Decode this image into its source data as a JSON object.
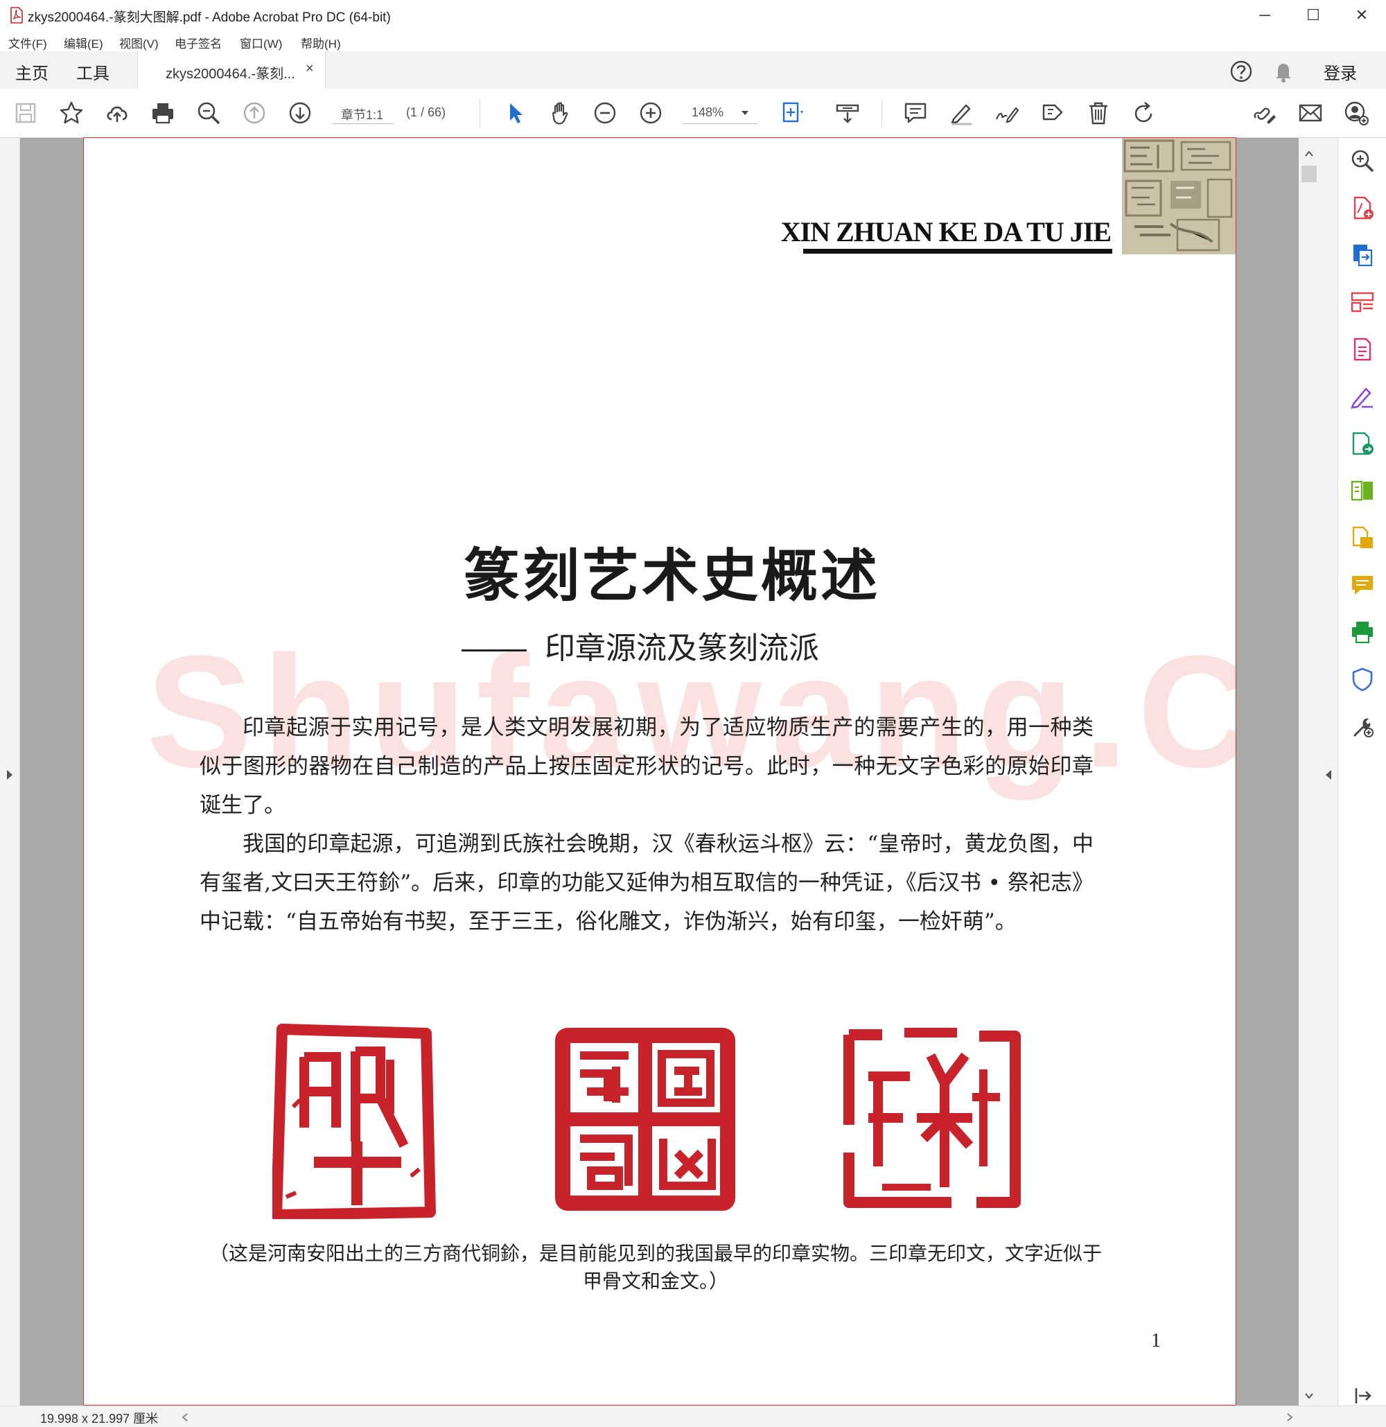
{
  "window": {
    "title": "zkys2000464.-篆刻大图解.pdf - Adobe Acrobat Pro DC (64-bit)",
    "minimize": "─",
    "maximize": "☐",
    "close": "✕"
  },
  "menu": [
    "文件(F)",
    "编辑(E)",
    "视图(V)",
    "电子签名",
    "窗口(W)",
    "帮助(H)"
  ],
  "tabs": {
    "home": "主页",
    "tools": "工具",
    "document": "zkys2000464.-篆刻...",
    "close": "×",
    "login": "登录"
  },
  "toolbar": {
    "chapter": "章节1:1",
    "page_count": "(1 / 66)",
    "zoom": "148%"
  },
  "page": {
    "header_en": "XIN ZHUAN KE DA TU JIE",
    "watermark": "Shufawang.CN",
    "title": "篆刻艺术史概述",
    "subtitle": "印章源流及篆刻流派",
    "paragraphs": [
      "印章起源于实用记号，是人类文明发展初期，为了适应物质生产的需要产生的，用一种类似于图形的器物在自己制造的产品上按压固定形状的记号。此时，一种无文字色彩的原始印章诞生了。",
      "我国的印章起源，可追溯到氏族社会晚期，汉《春秋运斗枢》云：“皇帝时，黄龙负图，中有玺者,文曰天王符鉩”。后来，印章的功能又延伸为相互取信的一种凭证，《后汉书 • 祭祀志》中记载：“自五帝始有书契，至于三王，俗化雕文，诈伪渐兴，始有印玺，一检奸萌”。"
    ],
    "caption": "（这是河南安阳出土的三方商代铜鉩，是目前能见到的我国最早的印章实物。三印章无印文，文字近似于甲骨文和金文。）",
    "page_number": "1"
  },
  "status": {
    "page_size": "19.998 x 21.997 厘米"
  },
  "colors": {
    "seal_red": "#c8222a",
    "accent_blue": "#1f6fd1",
    "page_border": "#dd3333"
  }
}
